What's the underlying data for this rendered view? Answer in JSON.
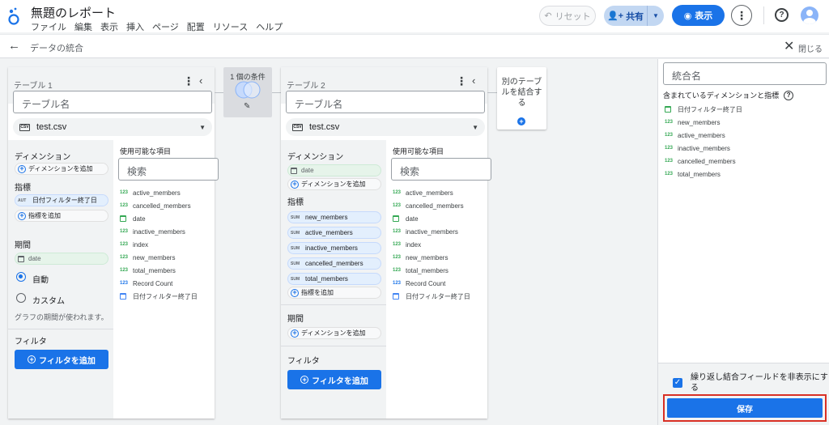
{
  "app": {
    "title": "無題のレポート",
    "menu": [
      "ファイル",
      "編集",
      "表示",
      "挿入",
      "ページ",
      "配置",
      "リソース",
      "ヘルプ"
    ],
    "reset_label": "リセット",
    "share_label": "共有",
    "view_label": "表示",
    "accent": "#1a73e8"
  },
  "subheader": {
    "title": "データの統合",
    "close_label": "閉じる"
  },
  "tables": [
    {
      "label": "テーブル 1",
      "name_placeholder": "テーブル名",
      "source": "test.csv",
      "dimension_title": "ディメンション",
      "add_dimension": "ディメンションを追加",
      "metric_title": "指標",
      "metrics": [
        {
          "badge": "AUT",
          "name": "日付フィルター終了日"
        }
      ],
      "add_metric": "指標を追加",
      "period_title": "期間",
      "period_field": "date",
      "radio_auto": "自動",
      "radio_custom": "カスタム",
      "period_hint": "グラフの期間が使われます。",
      "filter_title": "フィルタ",
      "add_filter": "フィルタを追加",
      "available_title": "使用可能な項目",
      "search_placeholder": "検索",
      "available": [
        {
          "type": "num",
          "name": "active_members"
        },
        {
          "type": "num",
          "name": "cancelled_members"
        },
        {
          "type": "date",
          "name": "date"
        },
        {
          "type": "num",
          "name": "inactive_members"
        },
        {
          "type": "num",
          "name": "index"
        },
        {
          "type": "num",
          "name": "new_members"
        },
        {
          "type": "num",
          "name": "total_members"
        },
        {
          "type": "numblue",
          "name": "Record Count"
        },
        {
          "type": "dategrey",
          "name": "日付フィルター終了日"
        }
      ]
    },
    {
      "label": "テーブル 2",
      "name_placeholder": "テーブル名",
      "source": "test.csv",
      "dimension_title": "ディメンション",
      "dimension_field": "date",
      "add_dimension": "ディメンションを追加",
      "metric_title": "指標",
      "metrics": [
        {
          "badge": "SUM",
          "name": "new_members"
        },
        {
          "badge": "SUM",
          "name": "active_members"
        },
        {
          "badge": "SUM",
          "name": "inactive_members"
        },
        {
          "badge": "SUM",
          "name": "cancelled_members"
        },
        {
          "badge": "SUM",
          "name": "total_members"
        }
      ],
      "add_metric": "指標を追加",
      "period_title": "期間",
      "add_period_dimension": "ディメンションを追加",
      "filter_title": "フィルタ",
      "add_filter": "フィルタを追加",
      "available_title": "使用可能な項目",
      "search_placeholder": "検索",
      "available": [
        {
          "type": "num",
          "name": "active_members"
        },
        {
          "type": "num",
          "name": "cancelled_members"
        },
        {
          "type": "date",
          "name": "date"
        },
        {
          "type": "num",
          "name": "inactive_members"
        },
        {
          "type": "num",
          "name": "index"
        },
        {
          "type": "num",
          "name": "new_members"
        },
        {
          "type": "num",
          "name": "total_members"
        },
        {
          "type": "numblue",
          "name": "Record Count"
        },
        {
          "type": "dategrey",
          "name": "日付フィルター終了日"
        }
      ]
    }
  ],
  "join": {
    "condition_label": "1 個の条件",
    "add_join_label": "別のテーブルを結合する"
  },
  "right_panel": {
    "name_placeholder": "統合名",
    "included_title": "含まれているディメンションと指標",
    "included": [
      {
        "type": "date",
        "name": "日付フィルター終了日"
      },
      {
        "type": "num",
        "name": "new_members"
      },
      {
        "type": "num",
        "name": "active_members"
      },
      {
        "type": "num",
        "name": "inactive_members"
      },
      {
        "type": "num",
        "name": "cancelled_members"
      },
      {
        "type": "num",
        "name": "total_members"
      }
    ],
    "hide_repeated_label": "繰り返し結合フィールドを非表示にする",
    "save_label": "保存"
  }
}
